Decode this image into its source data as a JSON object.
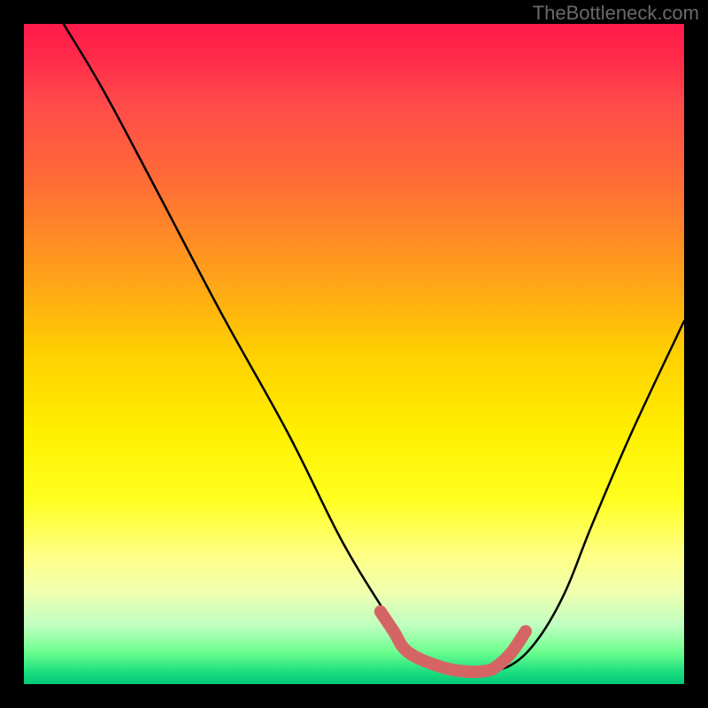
{
  "watermark": "TheBottleneck.com",
  "chart_data": {
    "type": "line",
    "title": "",
    "xlabel": "",
    "ylabel": "",
    "xlim": [
      0,
      100
    ],
    "ylim": [
      0,
      100
    ],
    "series": [
      {
        "name": "bottleneck-curve",
        "color": "#000000",
        "x": [
          6,
          12,
          20,
          30,
          40,
          48,
          54,
          58,
          62,
          66,
          70,
          74,
          78,
          82,
          86,
          92,
          100
        ],
        "y": [
          100,
          90,
          75,
          56,
          38,
          22,
          12,
          6,
          3,
          2,
          2,
          3,
          7,
          14,
          24,
          38,
          55
        ]
      },
      {
        "name": "optimal-zone",
        "color": "#d56565",
        "x": [
          54,
          56,
          58,
          62,
          66,
          70,
          72,
          74,
          76
        ],
        "y": [
          11,
          8,
          5,
          3,
          2,
          2,
          3,
          5,
          8
        ]
      }
    ],
    "gradient_stops": [
      {
        "pos": 0,
        "color": "#ff1a4a"
      },
      {
        "pos": 50,
        "color": "#ffd000"
      },
      {
        "pos": 80,
        "color": "#ffff80"
      },
      {
        "pos": 100,
        "color": "#00c878"
      }
    ]
  }
}
